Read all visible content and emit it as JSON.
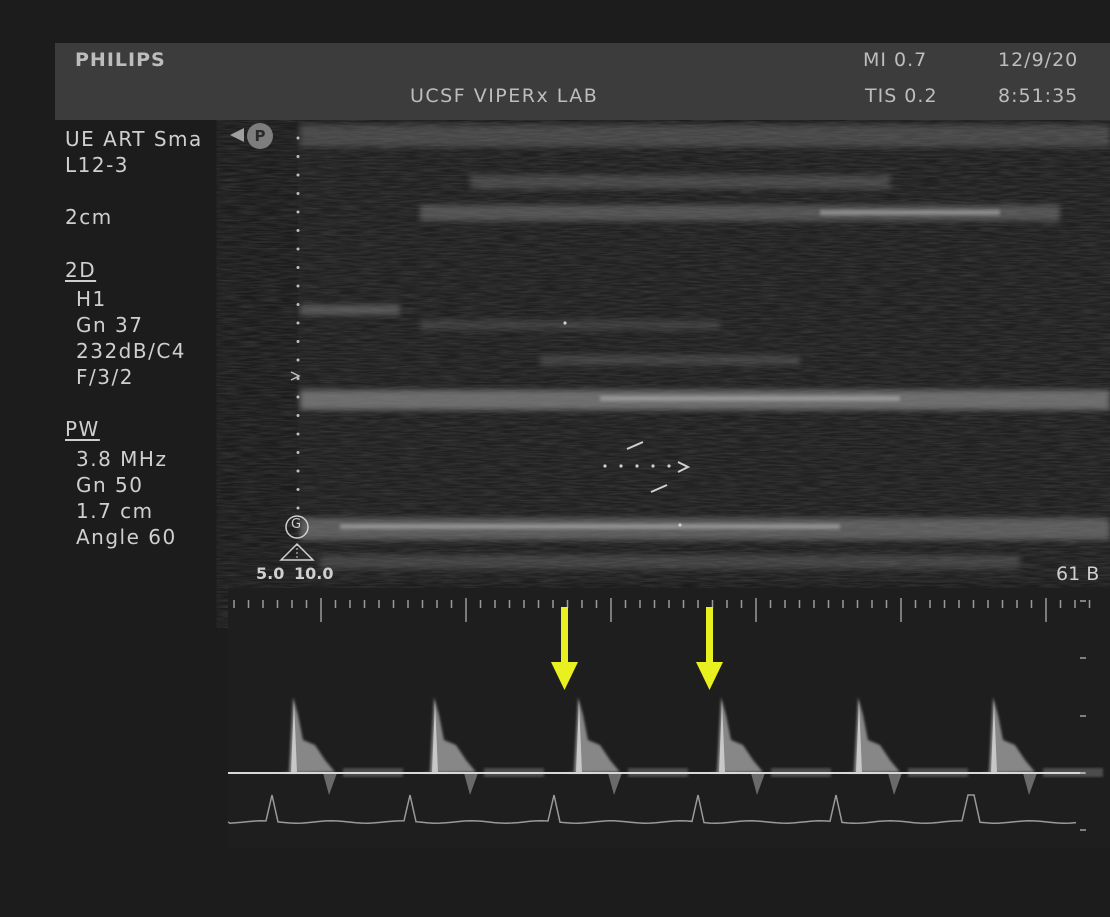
{
  "header": {
    "brand": "PHILIPS",
    "lab": "UCSF VIPERx LAB",
    "mi": "MI 0.7",
    "tis": "TIS 0.2",
    "date": "12/9/20",
    "time": "8:51:35"
  },
  "side": {
    "preset": "UE ART Sma",
    "probe": "L12-3",
    "depth": "2cm",
    "mode_2d": "2D",
    "h1": "H1",
    "gn_2d": "Gn 37",
    "dyn": "232dB/C4",
    "f": "F/3/2",
    "mode_pw": "PW",
    "freq": "3.8 MHz",
    "gn_pw": "Gn 50",
    "gate": "1.7 cm",
    "angle": "Angle 60"
  },
  "badges": {
    "p": "P",
    "g": "G"
  },
  "scale": {
    "left": "5.0",
    "right": "10.0",
    "bpm": "61 B"
  },
  "annotations": {
    "arrow_color": "#e8f020",
    "arrow_count": 2
  }
}
